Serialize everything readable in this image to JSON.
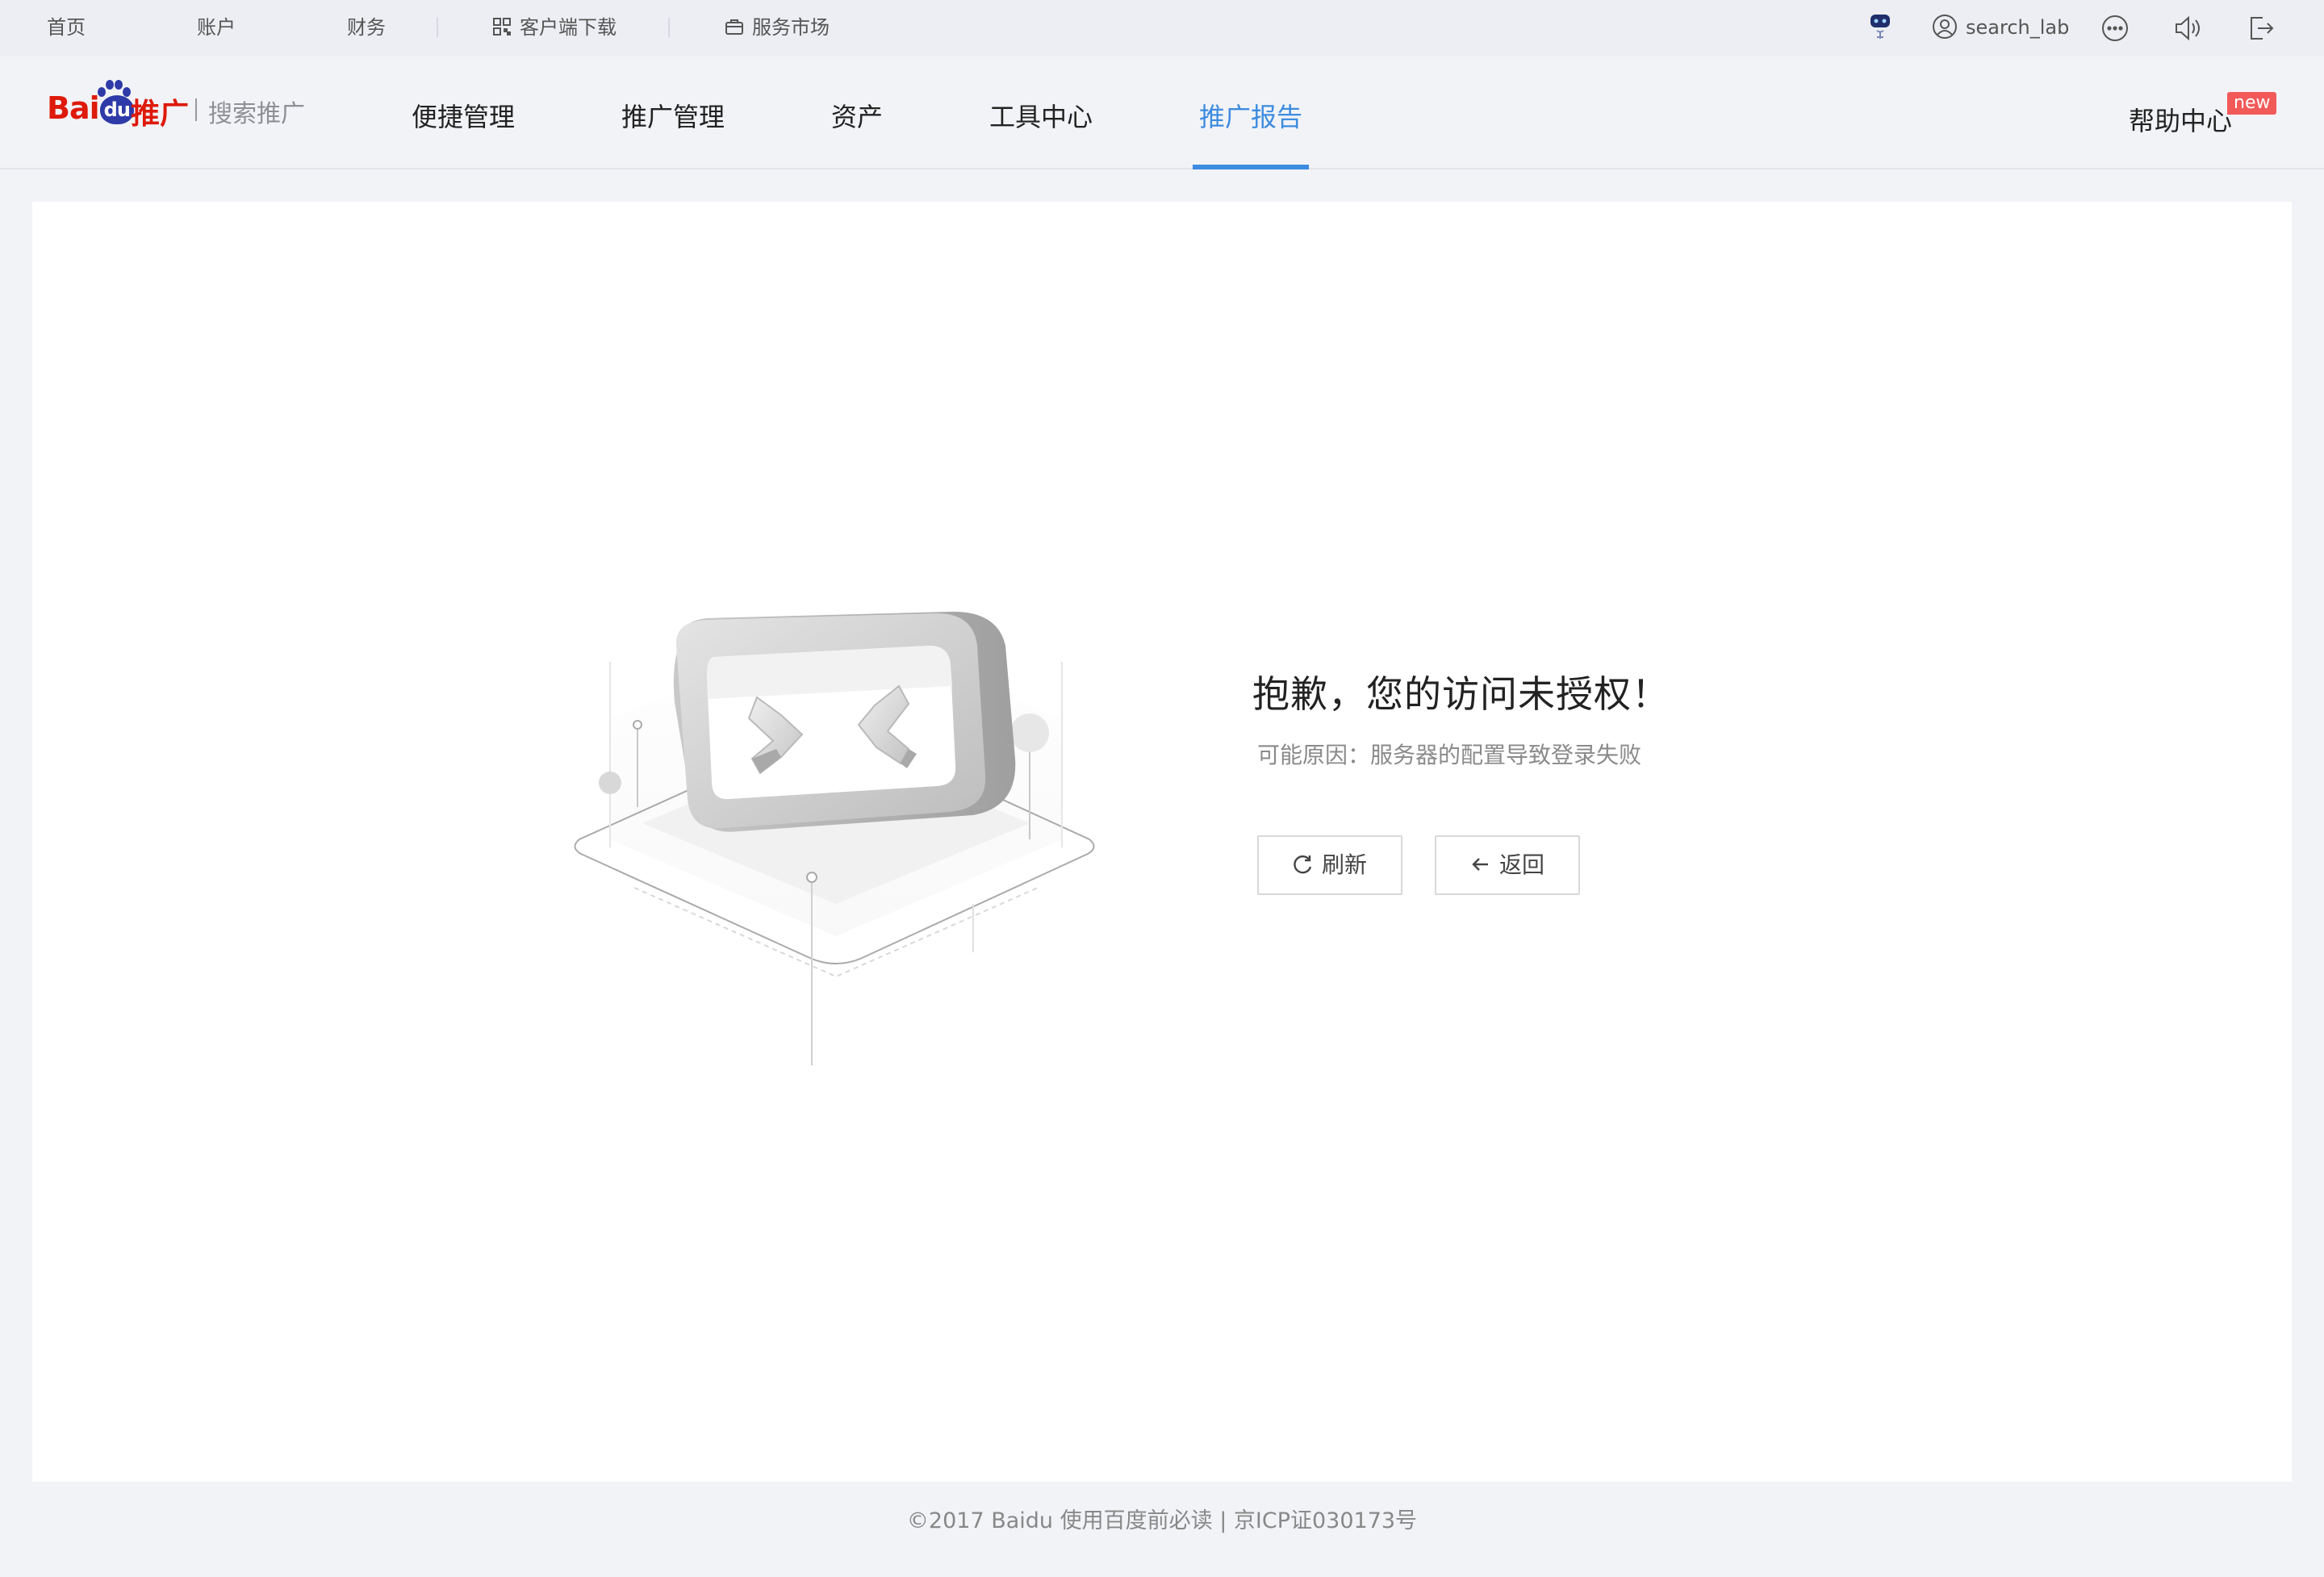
{
  "topbar": {
    "home": "首页",
    "account": "账户",
    "finance": "财务",
    "client_download": "客户端下载",
    "service_market": "服务市场",
    "username": "search_lab"
  },
  "logo": {
    "baidu_left": "Bai",
    "baidu_du": "du",
    "tuiguang": "推广",
    "sub": "搜索推广"
  },
  "nav": {
    "items": [
      "便捷管理",
      "推广管理",
      "资产",
      "工具中心",
      "推广报告"
    ],
    "active_index": 4,
    "help": "帮助中心",
    "help_badge": "new"
  },
  "error": {
    "title": "抱歉，您的访问未授权！",
    "reason": "可能原因：服务器的配置导致登录失败",
    "refresh_label": "刷新",
    "back_label": "返回"
  },
  "footer": {
    "text": "©2017 Baidu 使用百度前必读 | 京ICP证030173号"
  },
  "colors": {
    "accent": "#3d8ce0",
    "brand_red": "#de1a0b",
    "badge": "#f25a5a",
    "background": "#f2f3f7"
  },
  "icons": {
    "client_download": "qrcode-icon",
    "service_market": "bag-icon",
    "robot": "robot-icon",
    "user": "user-icon",
    "more": "more-icon",
    "sound": "speaker-icon",
    "logout": "logout-icon",
    "refresh": "refresh-icon",
    "back": "arrow-left-icon"
  }
}
